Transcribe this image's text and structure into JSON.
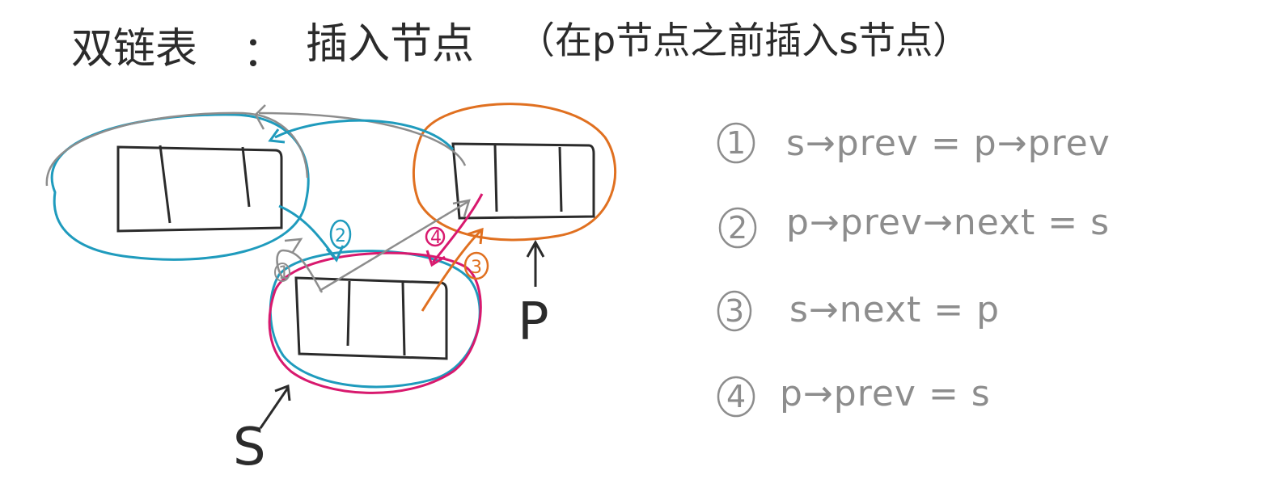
{
  "title": {
    "main": "双链表",
    "colon": "：",
    "topic": "插入节点",
    "note": "（在p节点之前插入s节点）"
  },
  "pointers": {
    "s_label": "S",
    "p_label": "P"
  },
  "markers": {
    "m1": "1",
    "m2": "2",
    "m3": "3",
    "m4": "4"
  },
  "steps": [
    {
      "num": "1",
      "text": "s→prev = p→prev"
    },
    {
      "num": "2",
      "text": "p→prev→next = s"
    },
    {
      "num": "3",
      "text": "s→next = p"
    },
    {
      "num": "4",
      "text": "p→prev = s"
    }
  ],
  "colors": {
    "ink": "#2b2b2b",
    "gray": "#8d8d8d",
    "blue": "#1f9bbd",
    "orange": "#e07020",
    "magenta": "#d8196e"
  }
}
